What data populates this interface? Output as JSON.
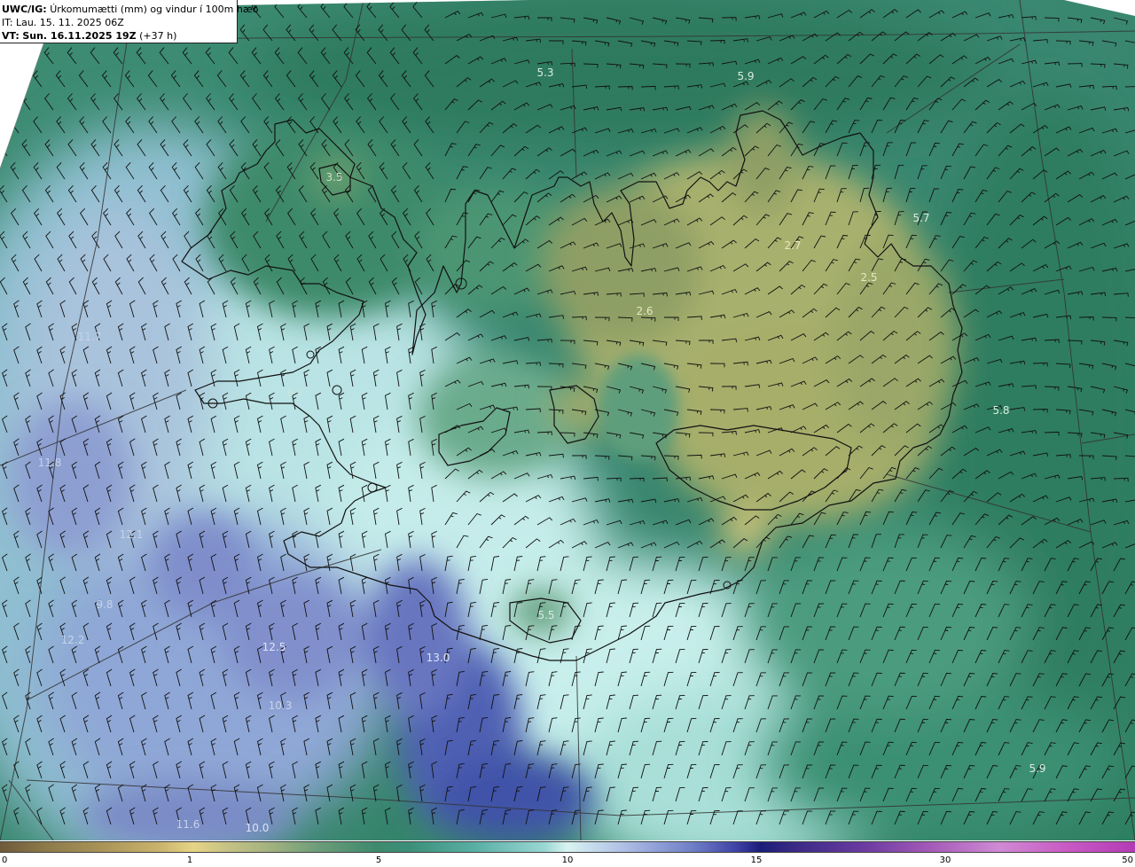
{
  "header": {
    "model_label": "UWC/IG:",
    "title": "Úrkomumætti (mm) og vindur í 100m hæð",
    "init_label": "IT:",
    "init_time": "Lau. 15. 11. 2025 06Z",
    "valid_label": "VT:",
    "valid_time": "Sun. 16.11.2025 19Z",
    "lead_time": "(+37 h)"
  },
  "value_labels": [
    "5.3",
    "5.9",
    "3.5",
    "5.7",
    "2.7",
    "2.5",
    "2.6",
    "11.7",
    "6.7",
    "5.8",
    "11.8",
    "12.1",
    "9.8",
    "12.2",
    "12.5",
    "13.0",
    "5.5",
    "10.3",
    "11.6",
    "10.0",
    "5.9"
  ],
  "colorbar": {
    "ticks": [
      "0",
      "1",
      "5",
      "10",
      "15",
      "30",
      "50"
    ]
  },
  "colors": {
    "land_sea_base": "#3f8a6e",
    "low_precip": "#b9b873",
    "mid_precip": "#6ea68c",
    "high_precip": "#b8e2e4",
    "very_high_precip": "#4a5fae",
    "coastline": "#111111"
  },
  "icons": [
    "wind-barb-icon"
  ]
}
